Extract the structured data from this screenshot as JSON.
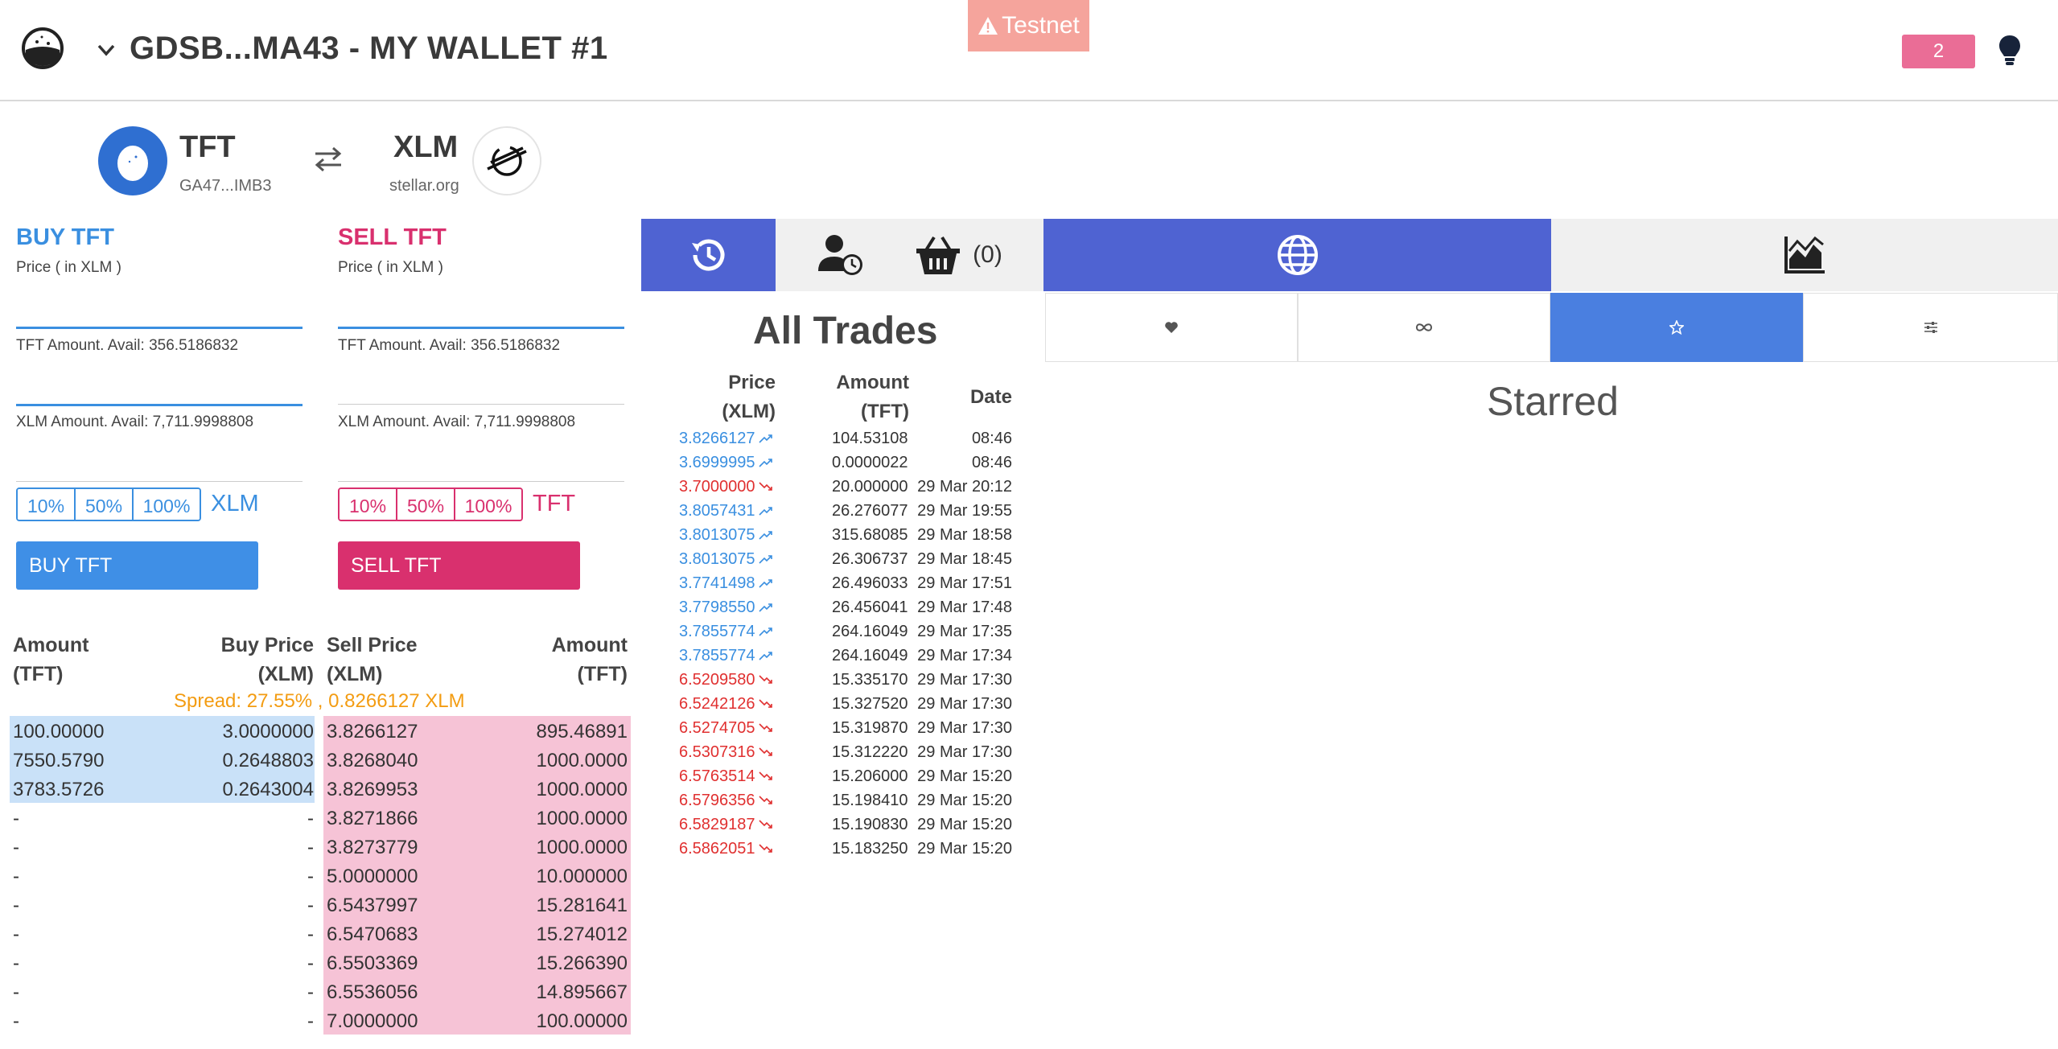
{
  "header": {
    "wallet_title": "GDSB...MA43 - MY WALLET #1",
    "testnet_label": "Testnet",
    "notification_count": "2"
  },
  "pair": {
    "base": {
      "code": "TFT",
      "issuer": "GA47...IMB3"
    },
    "counter": {
      "code": "XLM",
      "issuer": "stellar.org"
    }
  },
  "buy": {
    "title": "BUY TFT",
    "price_label": "Price ( in XLM )",
    "tft_amount_label": "TFT Amount. Avail: 356.5186832",
    "xlm_amount_label": "XLM Amount. Avail: 7,711.9998808",
    "pct": [
      "10%",
      "50%",
      "100%"
    ],
    "unit": "XLM",
    "button": "BUY TFT"
  },
  "sell": {
    "title": "SELL TFT",
    "price_label": "Price ( in XLM )",
    "tft_amount_label": "TFT Amount. Avail: 356.5186832",
    "xlm_amount_label": "XLM Amount. Avail: 7,711.9998808",
    "pct": [
      "10%",
      "50%",
      "100%"
    ],
    "unit": "TFT",
    "button": "SELL TFT"
  },
  "orderbook": {
    "headers": {
      "bid_amount": [
        "Amount",
        "(TFT)"
      ],
      "buy_price": [
        "Buy Price",
        "(XLM)"
      ],
      "sell_price": [
        "Sell Price",
        "(XLM)"
      ],
      "ask_amount": [
        "Amount",
        "(TFT)"
      ]
    },
    "spread": "Spread: 27.55% , 0.8266127 XLM",
    "rows": [
      {
        "bid_amount": "100.00000",
        "buy_price": "3.0000000",
        "sell_price": "3.8266127",
        "ask_amount": "895.46891"
      },
      {
        "bid_amount": "7550.5790",
        "buy_price": "0.2648803",
        "sell_price": "3.8268040",
        "ask_amount": "1000.0000"
      },
      {
        "bid_amount": "3783.5726",
        "buy_price": "0.2643004",
        "sell_price": "3.8269953",
        "ask_amount": "1000.0000"
      },
      {
        "bid_amount": "-",
        "buy_price": "-",
        "sell_price": "3.8271866",
        "ask_amount": "1000.0000"
      },
      {
        "bid_amount": "-",
        "buy_price": "-",
        "sell_price": "3.8273779",
        "ask_amount": "1000.0000"
      },
      {
        "bid_amount": "-",
        "buy_price": "-",
        "sell_price": "5.0000000",
        "ask_amount": "10.000000"
      },
      {
        "bid_amount": "-",
        "buy_price": "-",
        "sell_price": "6.5437997",
        "ask_amount": "15.281641"
      },
      {
        "bid_amount": "-",
        "buy_price": "-",
        "sell_price": "6.5470683",
        "ask_amount": "15.274012"
      },
      {
        "bid_amount": "-",
        "buy_price": "-",
        "sell_price": "6.5503369",
        "ask_amount": "15.266390"
      },
      {
        "bid_amount": "-",
        "buy_price": "-",
        "sell_price": "6.5536056",
        "ask_amount": "14.895667"
      },
      {
        "bid_amount": "-",
        "buy_price": "-",
        "sell_price": "7.0000000",
        "ask_amount": "100.00000"
      }
    ]
  },
  "tabs": {
    "cart_count": "(0)"
  },
  "trades": {
    "title": "All Trades",
    "headers": {
      "price": [
        "Price",
        "(XLM)"
      ],
      "amount": [
        "Amount",
        "(TFT)"
      ],
      "date": "Date"
    },
    "rows": [
      {
        "price": "3.8266127",
        "dir": "up",
        "amount": "104.53108",
        "date": "08:46"
      },
      {
        "price": "3.6999995",
        "dir": "up",
        "amount": "0.0000022",
        "date": "08:46"
      },
      {
        "price": "3.7000000",
        "dir": "down",
        "amount": "20.000000",
        "date": "29 Mar 20:12"
      },
      {
        "price": "3.8057431",
        "dir": "up",
        "amount": "26.276077",
        "date": "29 Mar 19:55"
      },
      {
        "price": "3.8013075",
        "dir": "up",
        "amount": "315.68085",
        "date": "29 Mar 18:58"
      },
      {
        "price": "3.8013075",
        "dir": "up",
        "amount": "26.306737",
        "date": "29 Mar 18:45"
      },
      {
        "price": "3.7741498",
        "dir": "up",
        "amount": "26.496033",
        "date": "29 Mar 17:51"
      },
      {
        "price": "3.7798550",
        "dir": "up",
        "amount": "26.456041",
        "date": "29 Mar 17:48"
      },
      {
        "price": "3.7855774",
        "dir": "up",
        "amount": "264.16049",
        "date": "29 Mar 17:35"
      },
      {
        "price": "3.7855774",
        "dir": "up",
        "amount": "264.16049",
        "date": "29 Mar 17:34"
      },
      {
        "price": "6.5209580",
        "dir": "down",
        "amount": "15.335170",
        "date": "29 Mar 17:30"
      },
      {
        "price": "6.5242126",
        "dir": "down",
        "amount": "15.327520",
        "date": "29 Mar 17:30"
      },
      {
        "price": "6.5274705",
        "dir": "down",
        "amount": "15.319870",
        "date": "29 Mar 17:30"
      },
      {
        "price": "6.5307316",
        "dir": "down",
        "amount": "15.312220",
        "date": "29 Mar 17:30"
      },
      {
        "price": "6.5763514",
        "dir": "down",
        "amount": "15.206000",
        "date": "29 Mar 15:20"
      },
      {
        "price": "6.5796356",
        "dir": "down",
        "amount": "15.198410",
        "date": "29 Mar 15:20"
      },
      {
        "price": "6.5829187",
        "dir": "down",
        "amount": "15.190830",
        "date": "29 Mar 15:20"
      },
      {
        "price": "6.5862051",
        "dir": "down",
        "amount": "15.183250",
        "date": "29 Mar 15:20"
      }
    ]
  },
  "markets": {
    "active_filter": "starred",
    "heading": "Starred"
  },
  "colors": {
    "buy": "#3a8fe0",
    "sell": "#d9306e",
    "tab_active": "#4f63d2",
    "subtab_active": "#4a7fe0",
    "tab_inactive": "#f0f0f0",
    "spread": "#f39c12",
    "bid_bg": "#c9e1f8",
    "ask_bg": "#f6c3d6"
  }
}
